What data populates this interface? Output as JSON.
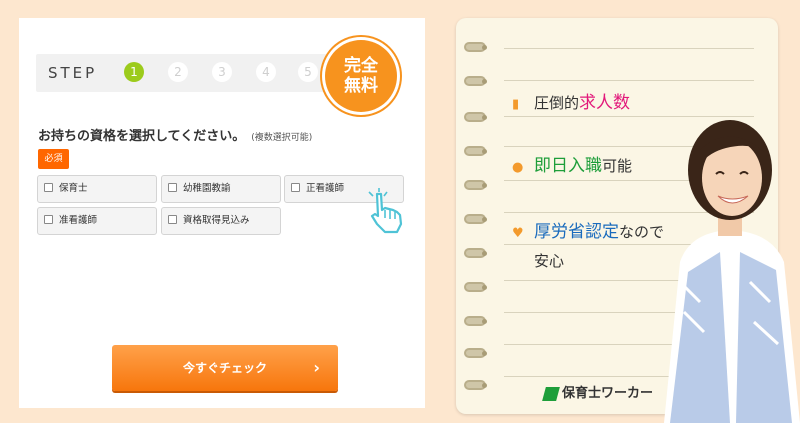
{
  "form": {
    "step_label": "STEP",
    "steps": [
      "1",
      "2",
      "3",
      "4",
      "5"
    ],
    "active_step": 1,
    "badge_line1": "完全",
    "badge_line2": "無料",
    "question": "お持ちの資格を選択してください。",
    "question_note": "(複数選択可能)",
    "required_label": "必須",
    "options": [
      "保育士",
      "幼稚園教諭",
      "正看護師",
      "准看護師",
      "資格取得見込み"
    ],
    "submit_label": "今すぐチェック",
    "submit_arrow": "›"
  },
  "notebook": {
    "feature1_plain": "圧倒的",
    "feature1_hl": "求人数",
    "feature2_hl": "即日入職",
    "feature2_plain": "可能",
    "feature3_hl": "厚労省認定",
    "feature3_plain": "なので",
    "feature3_line2": "安心",
    "logo_text": "保育士ワーカー"
  },
  "colors": {
    "background": "#fde7cf",
    "accent_orange": "#f7931e",
    "step_active": "#9ccb1c",
    "required": "#ff6700",
    "highlight_pink": "#e2197b",
    "highlight_green": "#1e9e3a",
    "highlight_blue": "#1a6bbd"
  },
  "icons": [
    "document-icon",
    "person-icon",
    "heart-icon",
    "pointing-hand-icon",
    "chevron-right-icon",
    "logo-mark-icon"
  ]
}
